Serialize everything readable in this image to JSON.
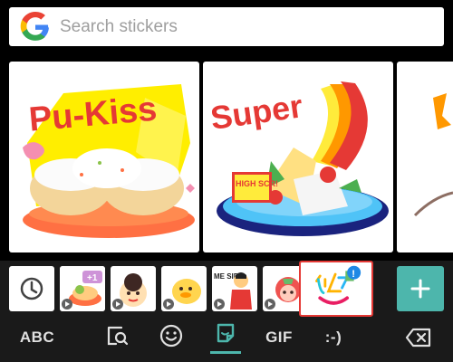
{
  "search": {
    "placeholder": "Search stickers"
  },
  "stickers": [
    {
      "name": "pu-kiss",
      "text": "Pu-Kiss"
    },
    {
      "name": "super",
      "text": "Super",
      "badge_text": "HIGH SCR!"
    },
    {
      "name": "partial"
    }
  ],
  "packs": [
    {
      "name": "recent"
    },
    {
      "name": "pack-1",
      "badge": "+1"
    },
    {
      "name": "pack-2"
    },
    {
      "name": "pack-3"
    },
    {
      "name": "pack-4",
      "label": "ME SIP"
    },
    {
      "name": "pack-5"
    },
    {
      "name": "pack-6",
      "badge": "!"
    }
  ],
  "toolbar": {
    "abc_label": "ABC",
    "gif_label": "GIF",
    "emoticon_label": ":-)"
  },
  "colors": {
    "accent": "#4db6ac",
    "selected_border": "#e53935",
    "background": "#000000"
  }
}
